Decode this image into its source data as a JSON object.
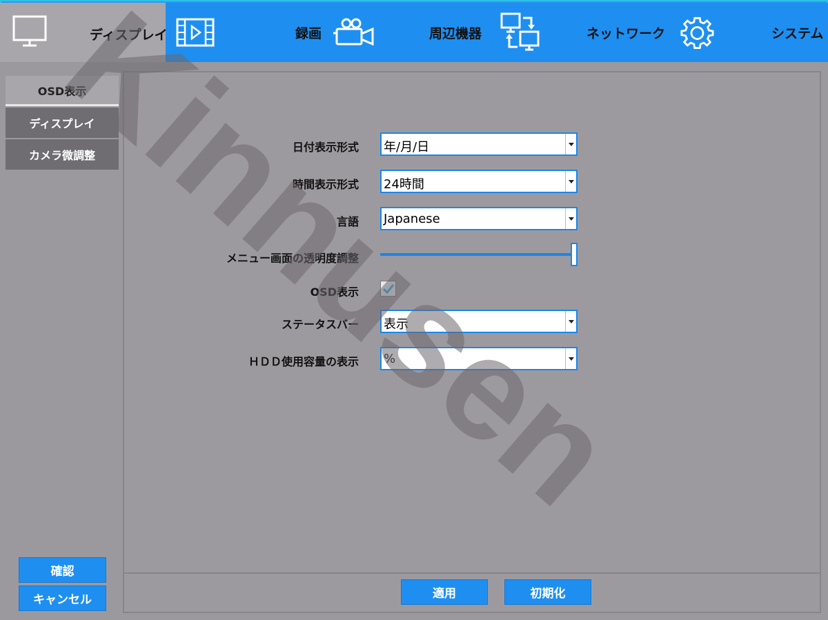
{
  "topnav": {
    "tabs": [
      {
        "label": "ディスプレイ",
        "icon": "monitor-icon"
      },
      {
        "label": "",
        "icon": "video-playback-icon"
      },
      {
        "label": "録画",
        "icon": "video-camera-icon"
      },
      {
        "label": "周辺機器",
        "icon": "devices-icon"
      },
      {
        "label": "ネットワーク",
        "icon": "gear-icon"
      },
      {
        "label": "システム",
        "icon": ""
      }
    ]
  },
  "sidebar": {
    "items": [
      {
        "label": "OSD表示",
        "state": "active"
      },
      {
        "label": "ディスプレイ",
        "state": "inactive"
      },
      {
        "label": "カメラ微調整",
        "state": "inactive"
      }
    ],
    "confirm_label": "確認",
    "cancel_label": "キャンセル"
  },
  "form": {
    "date_format_label": "日付表示形式",
    "date_format_value": "年/月/日",
    "time_format_label": "時間表示形式",
    "time_format_value": "24時間",
    "language_label": "言語",
    "language_value": "Japanese",
    "transparency_label": "メニュー画面の透明度調整",
    "transparency_value": 1.0,
    "osd_label": "OSD表示",
    "osd_checked": true,
    "statusbar_label": "ステータスバー",
    "statusbar_value": "表示",
    "hdd_label": "ＨＤＤ使用容量の表示",
    "hdd_value": "%"
  },
  "footer": {
    "apply_label": "適用",
    "reset_label": "初期化"
  },
  "watermark_text": "Kinnusen",
  "colors": {
    "accent": "#1e8ff0",
    "panel": "#9c999e",
    "active_tab": "#a9a6ab"
  }
}
